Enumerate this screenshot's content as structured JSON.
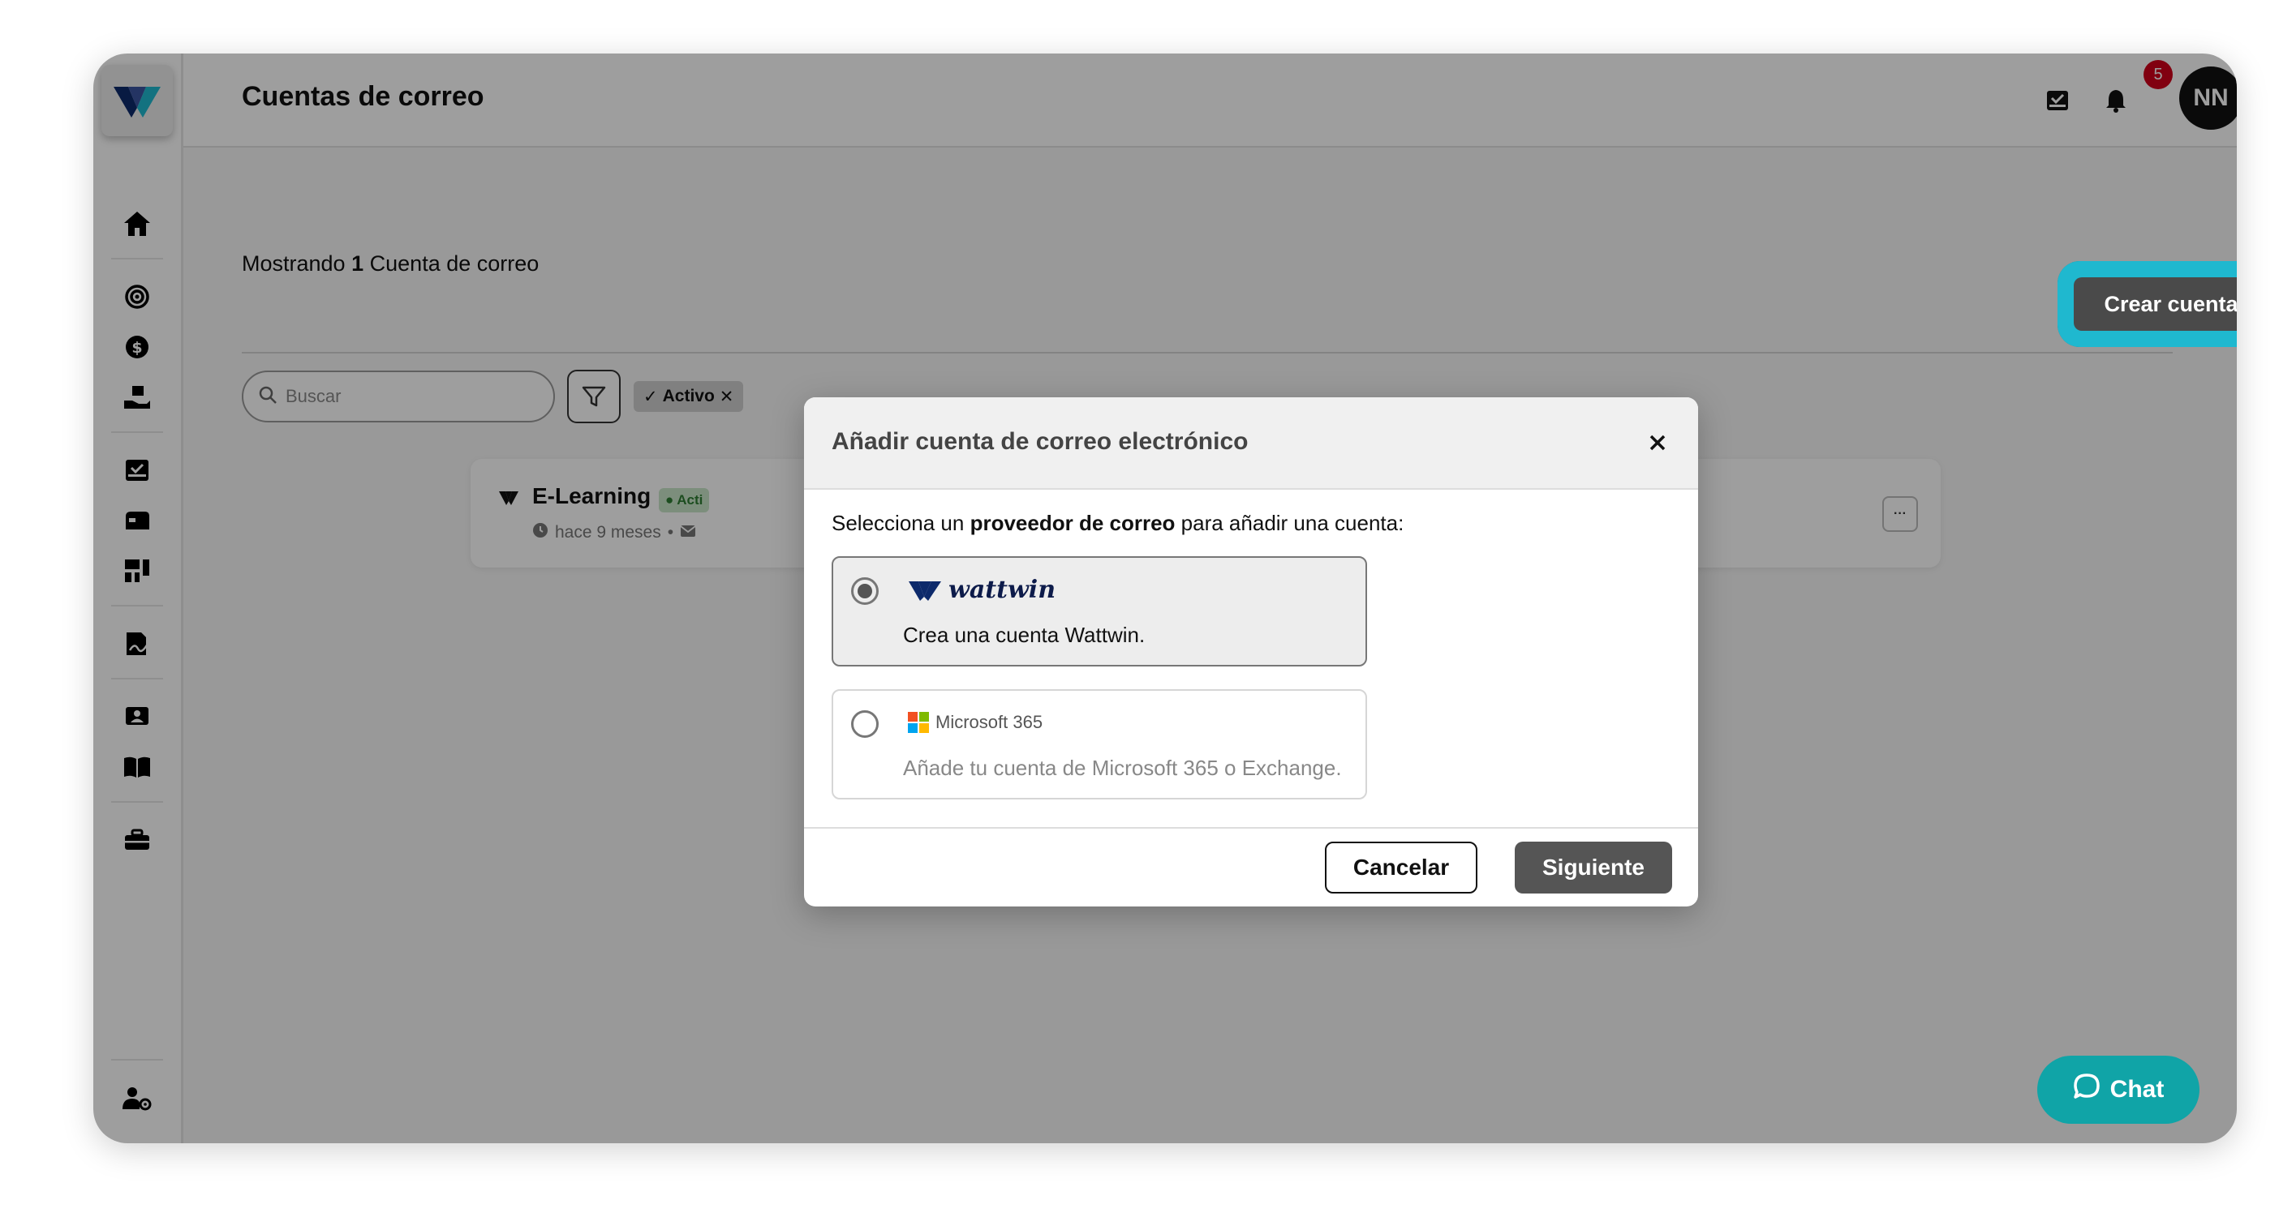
{
  "header": {
    "title": "Cuentas de correo",
    "notification_count": "5",
    "avatar_initials": "NN"
  },
  "main": {
    "showing_prefix": "Mostrando",
    "showing_count": "1",
    "showing_suffix": "Cuenta de correo",
    "create_button": "Crear cuenta",
    "search_placeholder": "Buscar",
    "filter_chip": "Activo"
  },
  "account": {
    "name": "E-Learning",
    "status": "Acti",
    "time": "hace 9 meses"
  },
  "modal": {
    "title": "Añadir cuenta de correo electrónico",
    "intro_prefix": "Selecciona un",
    "intro_bold": "proveedor de correo",
    "intro_suffix": "para añadir una cuenta:",
    "options": [
      {
        "brand": "wattwin",
        "description": "Crea una cuenta Wattwin.",
        "selected": true
      },
      {
        "brand": "Microsoft 365",
        "description": "Añade tu cuenta de Microsoft 365 o Exchange.",
        "selected": false
      }
    ],
    "cancel_label": "Cancelar",
    "next_label": "Siguiente"
  },
  "chat": {
    "label": "Chat"
  },
  "colors": {
    "accent_teal": "#10a4a7",
    "highlight_ring": "#1fb8cf",
    "badge_red": "#d0011b",
    "brand_navy": "#0d1b4a"
  },
  "icons": [
    "home-icon",
    "target-icon",
    "dollar-icon",
    "hand-box-icon",
    "inbox-check-icon",
    "mailbox-icon",
    "dashboard-icon",
    "signature-icon",
    "contacts-icon",
    "book-icon",
    "toolbox-icon",
    "user-settings-icon",
    "bell-icon",
    "search-icon",
    "filter-icon",
    "close-icon",
    "chat-icon"
  ]
}
